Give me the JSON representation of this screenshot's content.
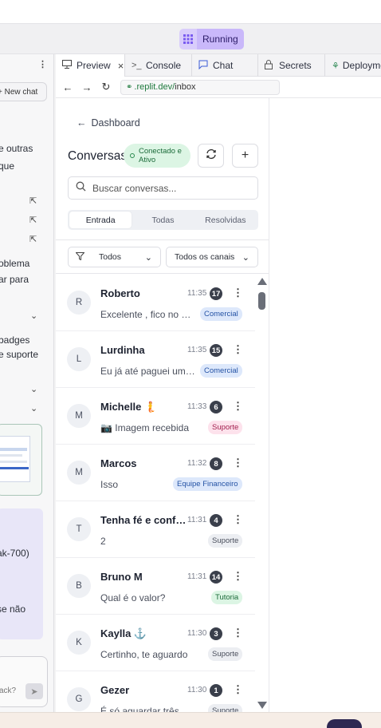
{
  "workspace": {
    "run_button_label": "Running"
  },
  "left_panel": {
    "new_chat_label": "+ New chat",
    "fragments": [
      "e outras",
      "que",
      "oblema",
      "ar para",
      "badges",
      "e suporte",
      "ak-700)",
      "se não",
      "ack?"
    ]
  },
  "tabs": [
    {
      "label": "Preview",
      "icon": "monitor-icon"
    },
    {
      "label": "Console",
      "icon": "terminal-icon"
    },
    {
      "label": "Chat",
      "icon": "chat-icon"
    },
    {
      "label": "Secrets",
      "icon": "lock-icon"
    },
    {
      "label": "Deployme",
      "icon": "deploy-icon"
    }
  ],
  "browser": {
    "url_domain": ".replit.dev/",
    "url_path": "inbox"
  },
  "inbox": {
    "back_label": "Dashboard",
    "title": "Conversas",
    "status_line1": "Conectado e",
    "status_line2": "Ativo",
    "search_placeholder": "Buscar conversas...",
    "segments": [
      "Entrada",
      "Todas",
      "Resolvidas"
    ],
    "active_segment": "Entrada",
    "filter_status": "Todos",
    "filter_channel": "Todos os canais",
    "conversations": [
      {
        "initial": "R",
        "name": "Roberto",
        "time": "11:35",
        "count": "17",
        "preview": "Excelente , fico no aguardo",
        "tag": "Comercial",
        "tag_color": "#dde8fb"
      },
      {
        "initial": "L",
        "name": "Lurdinha",
        "time": "11:35",
        "count": "15",
        "preview": "Eu já até paguei um valor",
        "tag": "Comercial",
        "tag_color": "#dde8fb"
      },
      {
        "initial": "M",
        "name": "Michelle 🧜",
        "time": "11:33",
        "count": "6",
        "preview": "📷 Imagem recebida",
        "tag": "Suporte",
        "tag_color": "#fde2ec"
      },
      {
        "initial": "M",
        "name": "Marcos",
        "time": "11:32",
        "count": "8",
        "preview": "Isso",
        "tag": "Equipe Financeiro",
        "tag_color": "#dde8fb"
      },
      {
        "initial": "T",
        "name": "Tenha fé e confiança",
        "time": "11:31",
        "count": "4",
        "preview": "2",
        "tag": "Suporte",
        "tag_color": "#eceef2"
      },
      {
        "initial": "B",
        "name": "Bruno M",
        "time": "11:31",
        "count": "14",
        "preview": "Qual é o valor?",
        "tag": "Tutoria",
        "tag_color": "#dcf5e4"
      },
      {
        "initial": "K",
        "name": "Kaylla ⚓",
        "time": "11:30",
        "count": "3",
        "preview": "Certinho, te aguardo",
        "tag": "Suporte",
        "tag_color": "#eceef2"
      },
      {
        "initial": "G",
        "name": "Gezer",
        "time": "11:30",
        "count": "1",
        "preview": "É só aguardar três meses",
        "tag": "Suporte",
        "tag_color": "#eceef2"
      }
    ]
  }
}
